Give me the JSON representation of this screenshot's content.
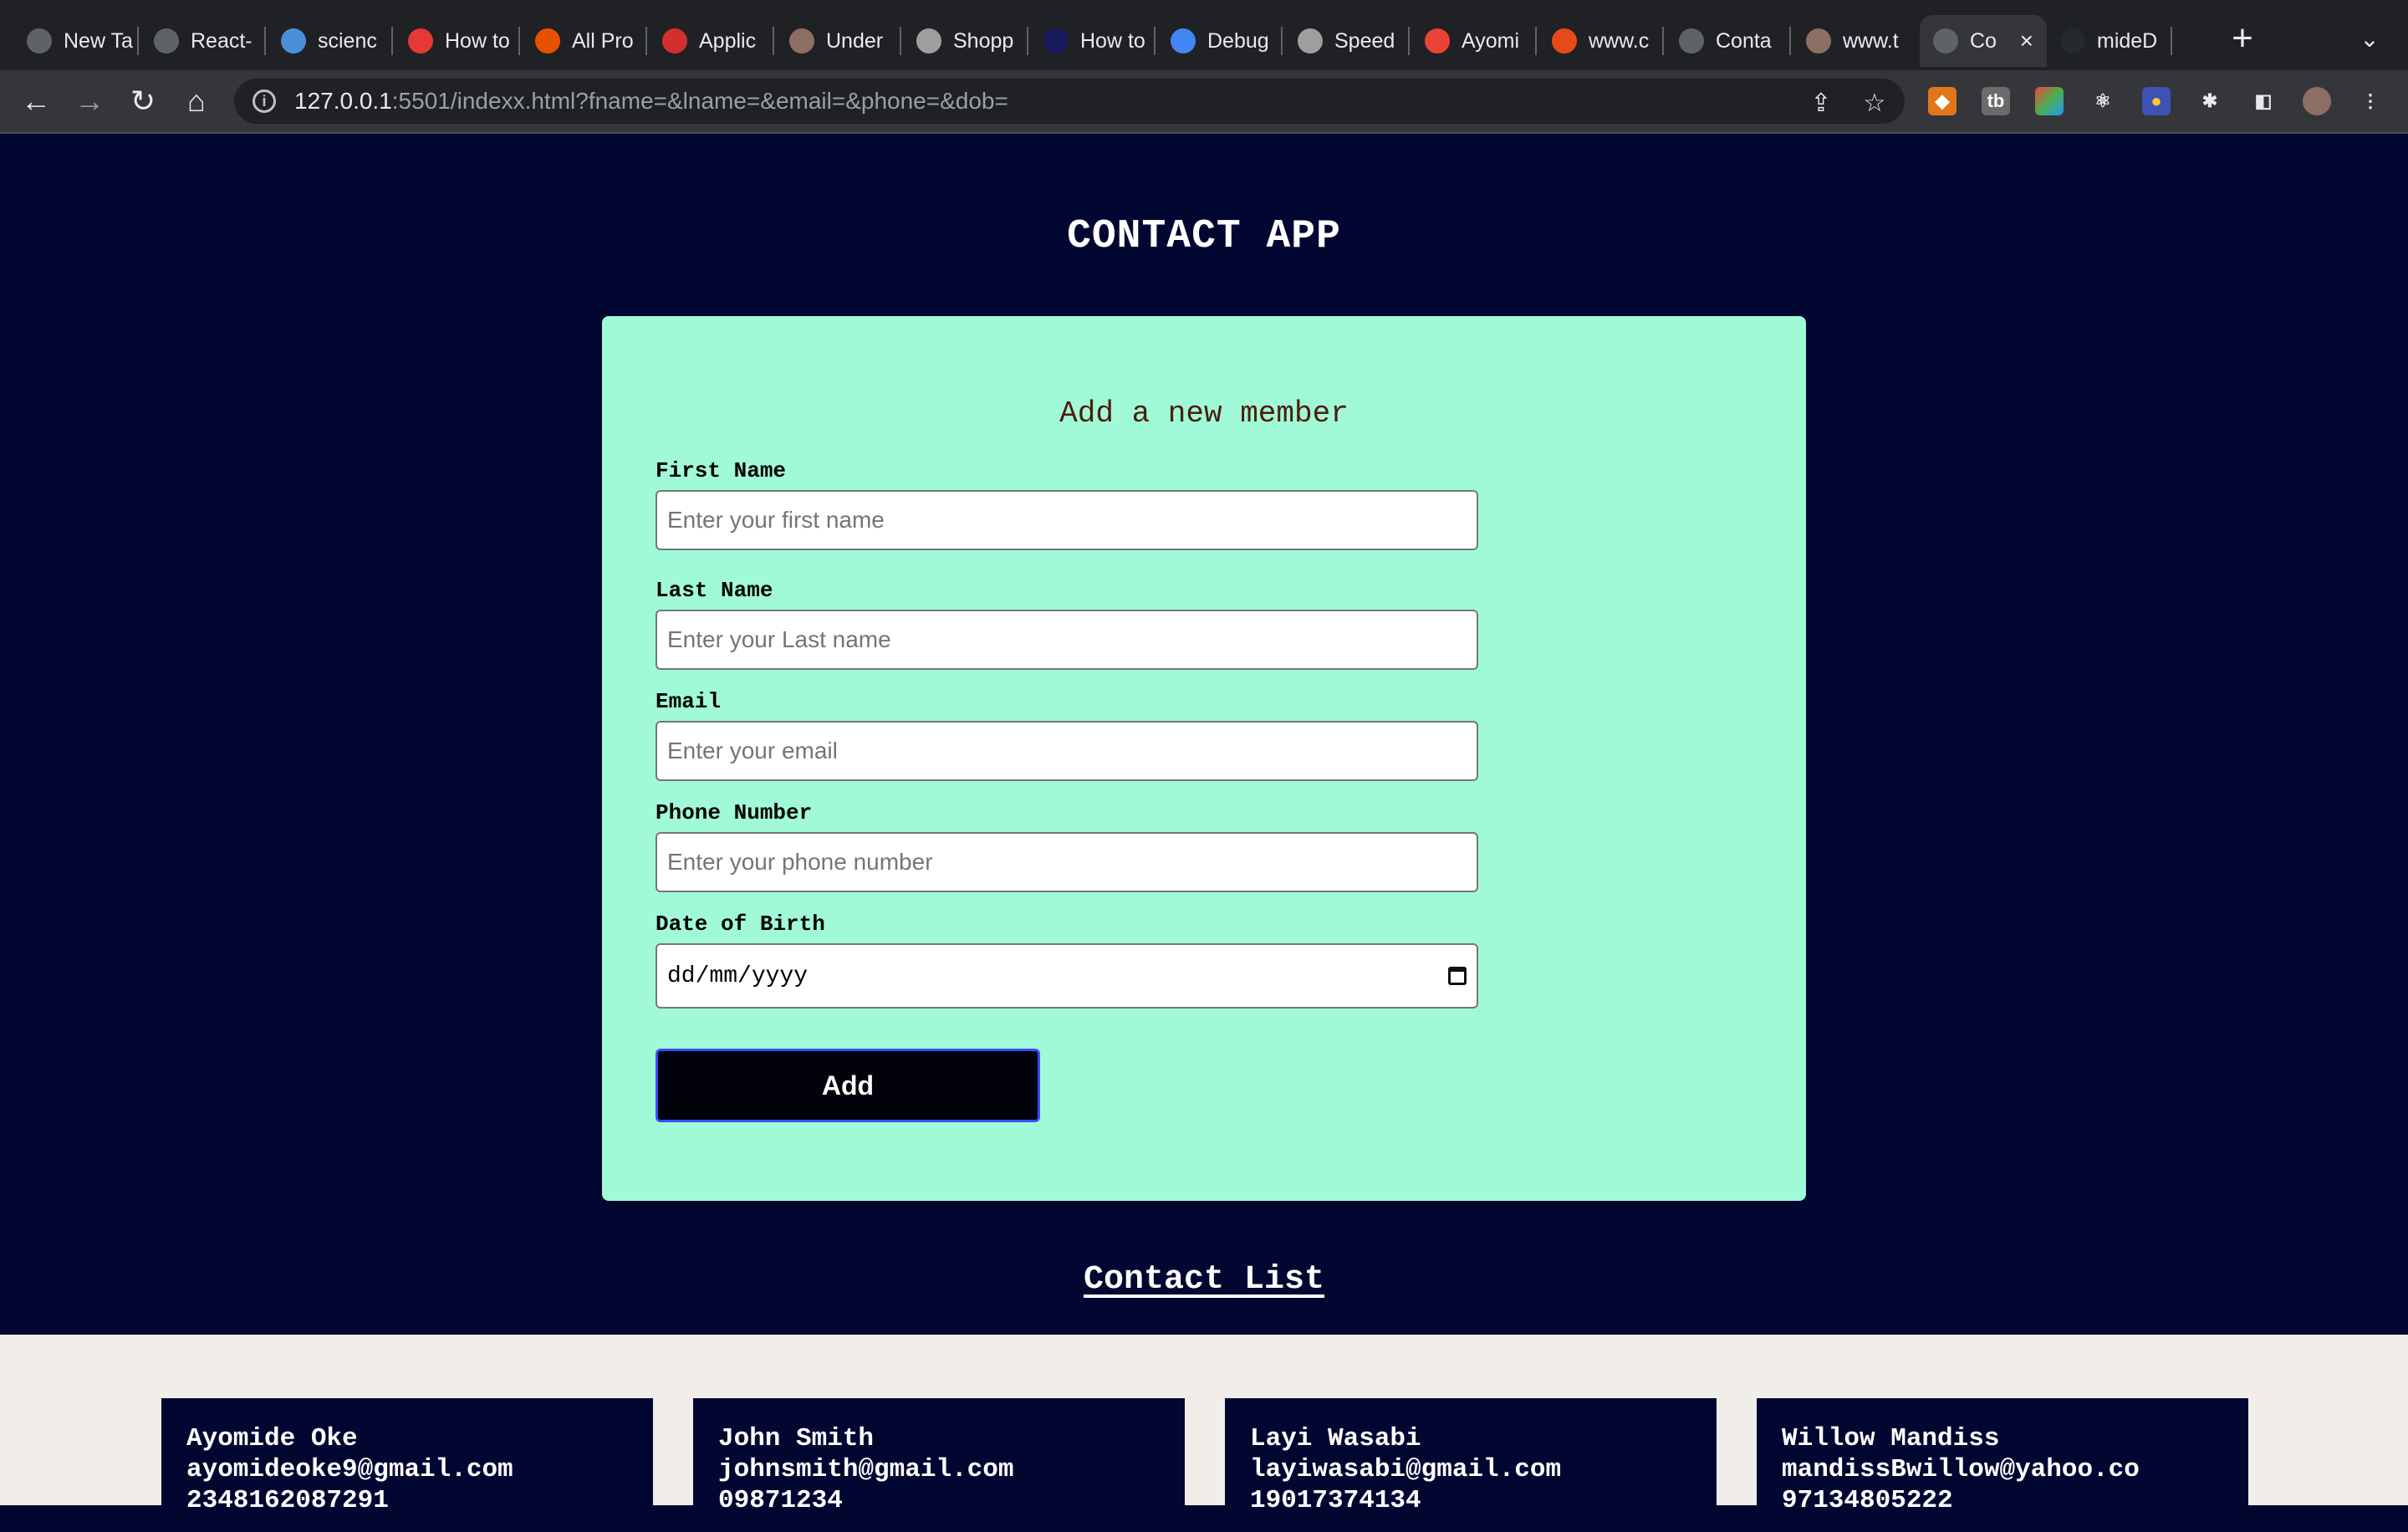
{
  "browser": {
    "tabs": [
      {
        "label": "New Ta",
        "icon": "globe-icon",
        "color": "#5f6368"
      },
      {
        "label": "React-",
        "icon": "square-icon",
        "color": "#5f6368"
      },
      {
        "label": "scienc",
        "icon": "flask-icon",
        "color": "#4a90d9"
      },
      {
        "label": "How to",
        "icon": "cat-icon",
        "color": "#e53935"
      },
      {
        "label": "All Pro",
        "icon": "u-logo-icon",
        "color": "#e65100"
      },
      {
        "label": "Applic",
        "icon": "maple-leaf-icon",
        "color": "#d32f2f"
      },
      {
        "label": "Under",
        "icon": "mascot-icon",
        "color": "#8d6e63"
      },
      {
        "label": "Shopp",
        "icon": "page-icon",
        "color": "#9e9e9e"
      },
      {
        "label": "How to",
        "icon": "lambda-icon",
        "color": "#1a1a5e"
      },
      {
        "label": "Debug",
        "icon": "chrome-icon",
        "color": "#4285f4"
      },
      {
        "label": "Speed",
        "icon": "doc-icon",
        "color": "#9e9e9e"
      },
      {
        "label": "Ayomi",
        "icon": "gmail-icon",
        "color": "#ea4335"
      },
      {
        "label": "www.c",
        "icon": "fire-icon",
        "color": "#e64a19"
      },
      {
        "label": "Conta",
        "icon": "globe-icon",
        "color": "#5f6368"
      },
      {
        "label": "www.t",
        "icon": "mascot-icon",
        "color": "#8d6e63"
      },
      {
        "label": "Co",
        "icon": "globe-icon",
        "color": "#5f6368",
        "active": true
      },
      {
        "label": "mideD",
        "icon": "github-icon",
        "color": "#24292e"
      }
    ],
    "new_tab_label": "+",
    "url_host": "127.0.0.1",
    "url_rest": ":5501/indexx.html?fname=&lname=&email=&phone=&dob="
  },
  "app": {
    "title": "CONTACT APP",
    "form": {
      "heading": "Add a new member",
      "first_name_label": "First Name",
      "first_name_placeholder": "Enter your first name",
      "last_name_label": "Last Name",
      "last_name_placeholder": "Enter your Last name",
      "email_label": "Email",
      "email_placeholder": "Enter your email",
      "phone_label": "Phone Number",
      "phone_placeholder": "Enter your phone number",
      "dob_label": "Date of Birth",
      "dob_value": "dd/mm/yyyy",
      "add_button": "Add"
    },
    "contact_list_title": "Contact List",
    "contacts": [
      {
        "name": "Ayomide Oke",
        "email": "ayomideoke9@gmail.com",
        "phone": "2348162087291"
      },
      {
        "name": "John Smith",
        "email": "johnsmith@gmail.com",
        "phone": "09871234"
      },
      {
        "name": "Layi Wasabi",
        "email": "layiwasabi@gmail.com",
        "phone": "19017374134"
      },
      {
        "name": "Willow Mandiss",
        "email": "mandissBwillow@yahoo.co",
        "phone": "97134805222"
      }
    ]
  },
  "colors": {
    "page_bg": "#020732",
    "form_bg": "#a0fad8",
    "heading_color": "#4d1d0b",
    "list_bg": "#f1eee9"
  }
}
